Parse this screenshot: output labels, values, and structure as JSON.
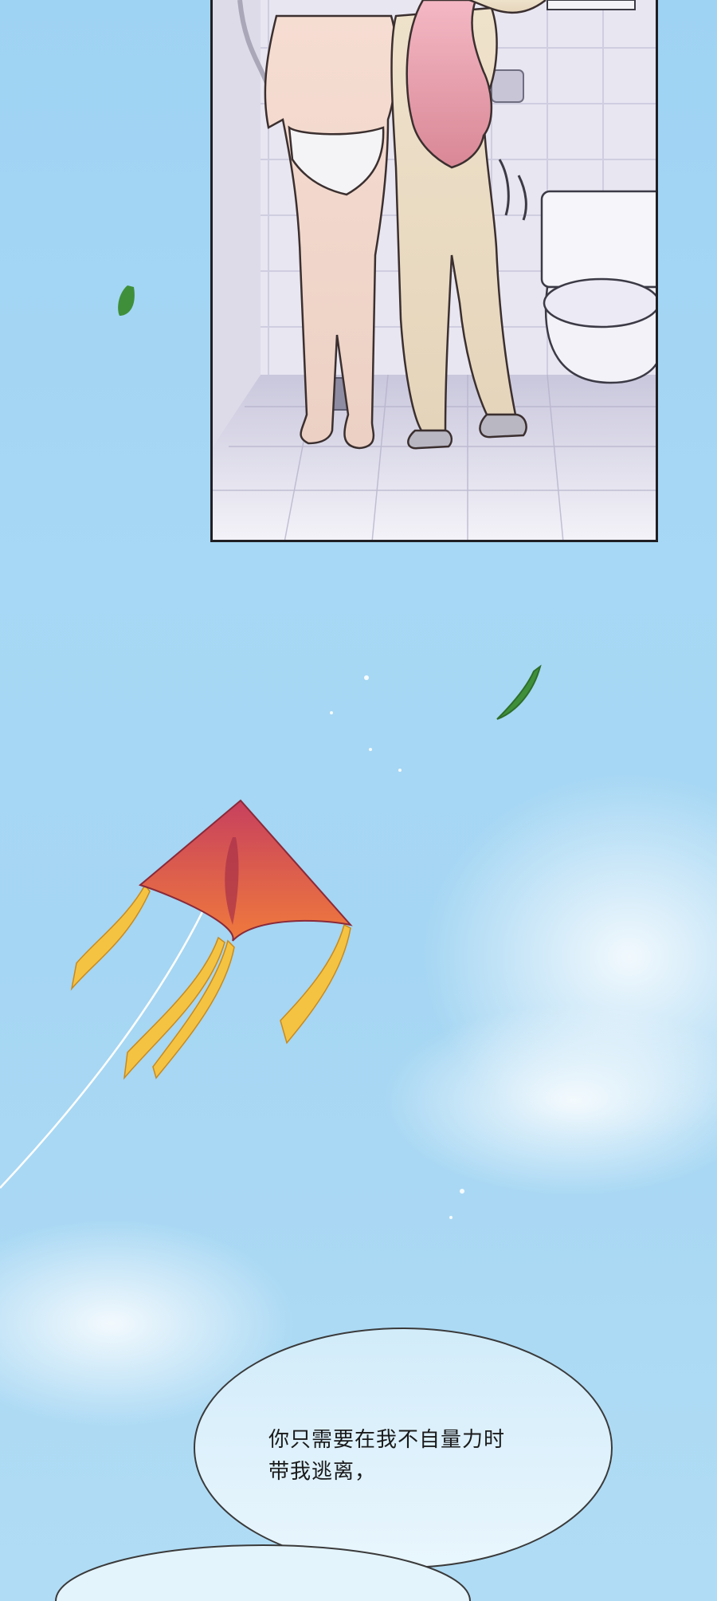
{
  "scene": {
    "panel_description_hidden": false,
    "colors": {
      "sky_top": "#9fd3f3",
      "sky_bottom": "#b1dcf5",
      "kite_top": "#c7405e",
      "kite_bottom": "#f07a3c",
      "tail": "#f5c342",
      "leaf": "#3f8f3a",
      "bubble_fill": "#dff1fb",
      "bubble_stroke": "#3a3a3a"
    }
  },
  "dialogue": {
    "line1": "你只需要在我不自量力时",
    "line2": "带我逃离，"
  }
}
